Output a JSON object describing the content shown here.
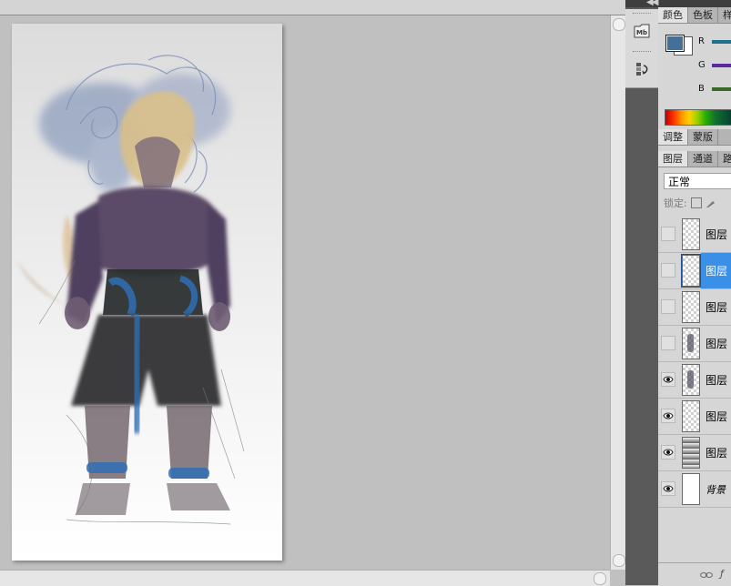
{
  "color_panel": {
    "tabs": [
      "颜色",
      "色板",
      "样"
    ],
    "active_tab": 0,
    "foreground_color": "#466f97",
    "background_color": "#ffffff",
    "channels": [
      {
        "label": "R",
        "color": "#1f6f8f"
      },
      {
        "label": "G",
        "color": "#5a2aa0"
      },
      {
        "label": "B",
        "color": "#3a6a2a"
      }
    ]
  },
  "adjust_tabs": [
    "调整",
    "蒙版"
  ],
  "layers_panel": {
    "tabs": [
      "图层",
      "通道",
      "路"
    ],
    "active_tab": 0,
    "blend_mode": "正常",
    "lock_label": "锁定:",
    "layers": [
      {
        "name": "图层",
        "visible": false,
        "selected": false,
        "thumb": "transparent"
      },
      {
        "name": "图层",
        "visible": false,
        "selected": true,
        "thumb": "transparent"
      },
      {
        "name": "图层",
        "visible": false,
        "selected": false,
        "thumb": "transparent"
      },
      {
        "name": "图层",
        "visible": false,
        "selected": false,
        "thumb": "figure"
      },
      {
        "name": "图层",
        "visible": true,
        "selected": false,
        "thumb": "figure"
      },
      {
        "name": "图层",
        "visible": true,
        "selected": false,
        "thumb": "transparent"
      },
      {
        "name": "图层",
        "visible": true,
        "selected": false,
        "thumb": "gradient"
      },
      {
        "name": "背景",
        "visible": true,
        "selected": false,
        "thumb": "white"
      }
    ]
  },
  "mini_toolbar": {
    "icons": [
      "mini-bridge-icon",
      "history-icon"
    ],
    "mini_bridge_label": "Mb"
  }
}
